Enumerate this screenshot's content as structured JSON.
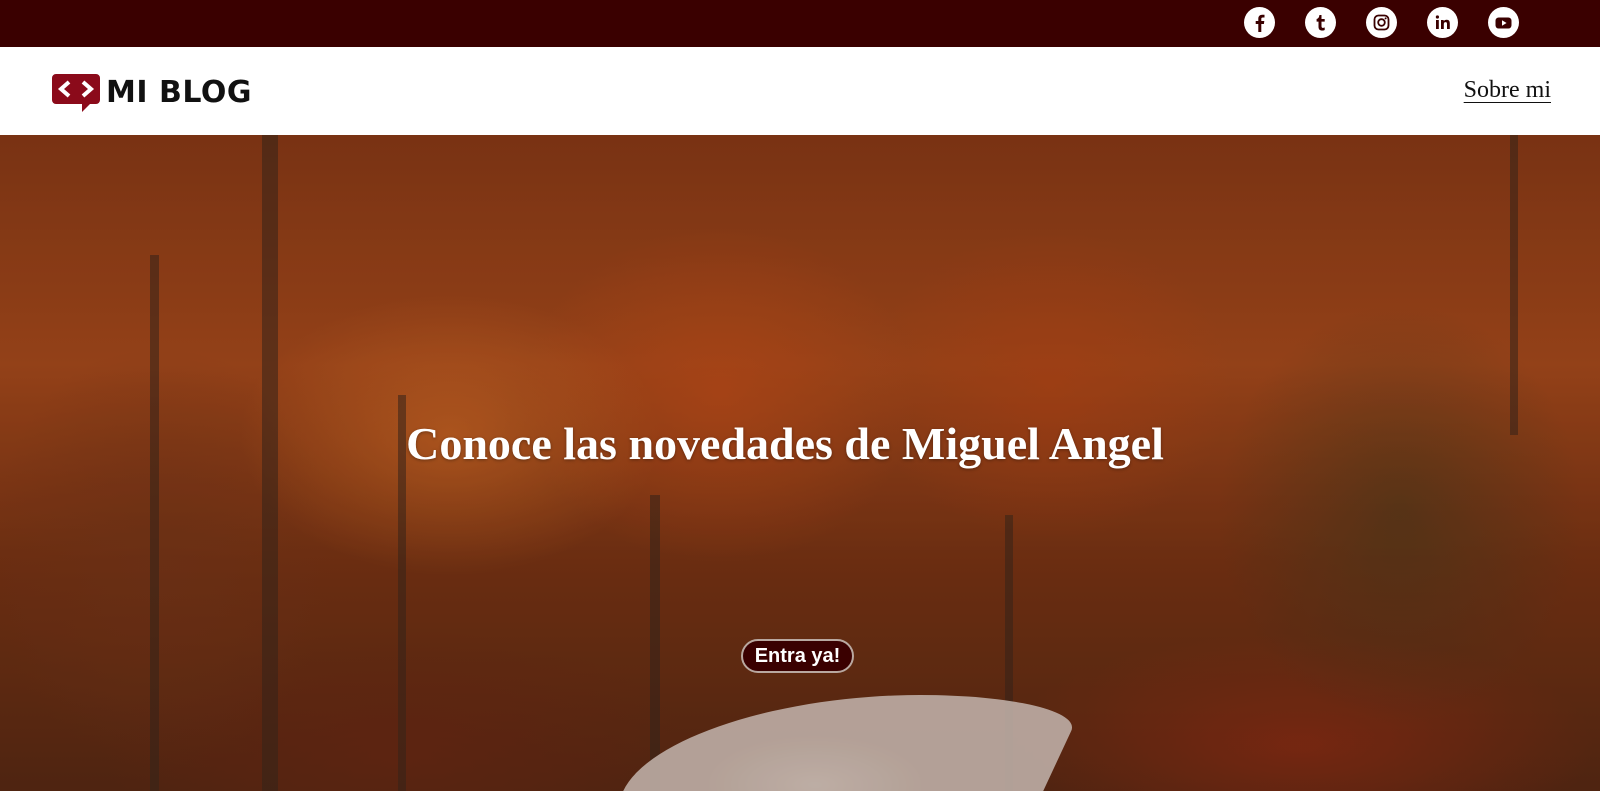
{
  "topbar": {
    "background": "#3a0000",
    "social": [
      {
        "name": "facebook-icon"
      },
      {
        "name": "tumblr-icon"
      },
      {
        "name": "instagram-icon"
      },
      {
        "name": "linkedin-icon"
      },
      {
        "name": "youtube-icon"
      }
    ]
  },
  "header": {
    "logo_text": "MI BLOG",
    "logo_icon": "code-chat-bubble-icon",
    "logo_color": "#8b0a1a",
    "nav": [
      {
        "label": "Sobre mi"
      }
    ]
  },
  "hero": {
    "title": "Conoce las novedades de Miguel Angel",
    "cta_label": "Entra ya!",
    "cta_color": "#3a0000",
    "image": "autumn-forest-road"
  }
}
